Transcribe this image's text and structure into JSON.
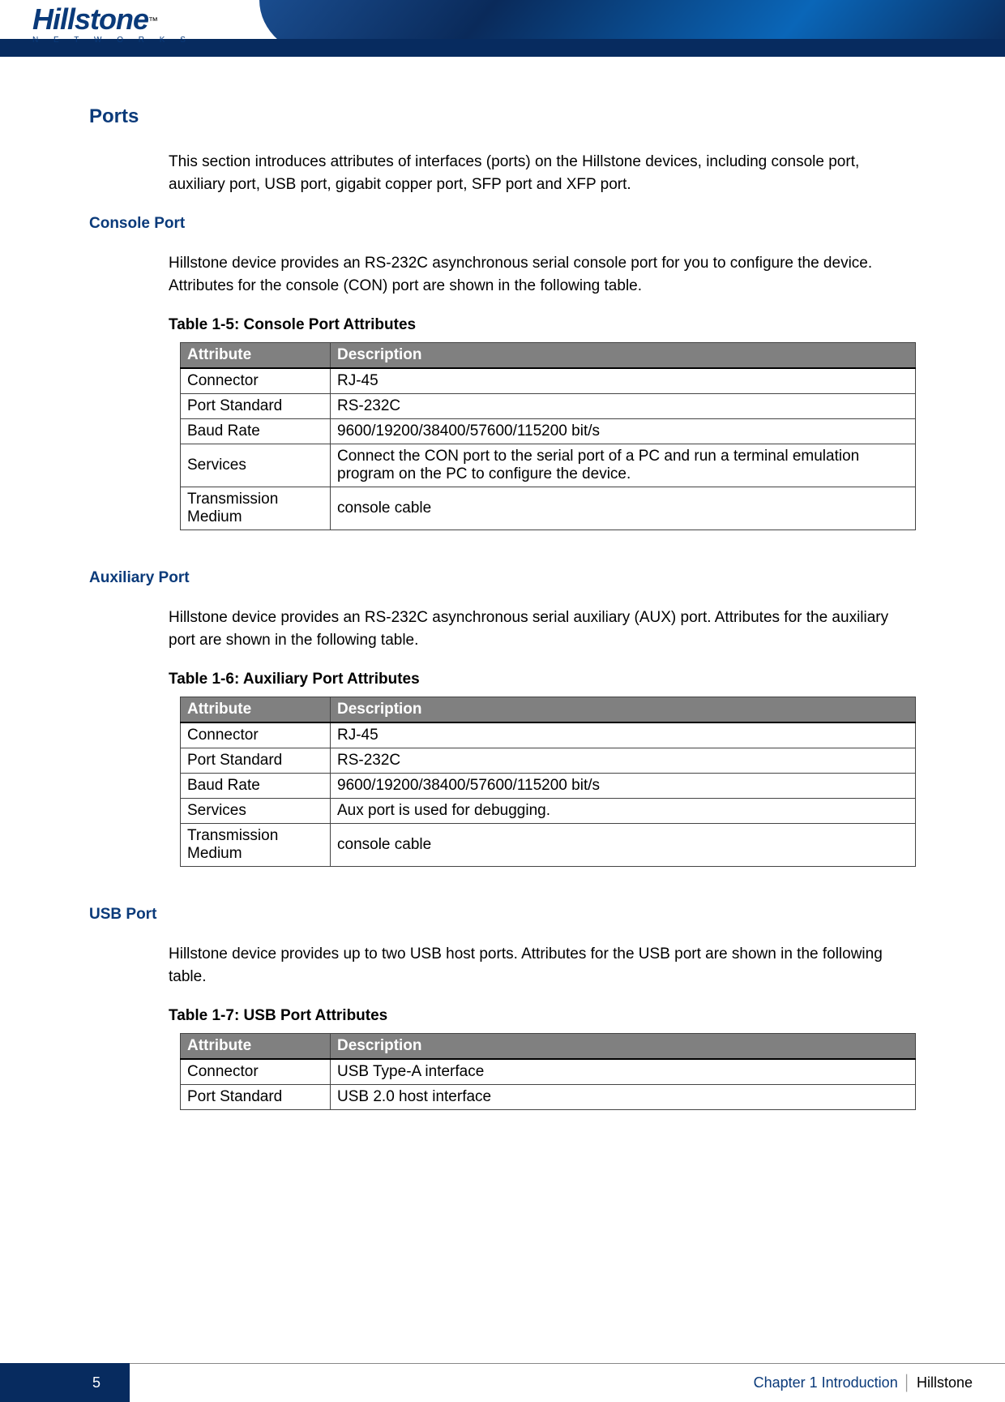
{
  "logo": {
    "text": "Hillstone",
    "tm": "™",
    "sub": "N E T W O R K S"
  },
  "sections": {
    "ports": {
      "title": "Ports",
      "intro": "This section introduces attributes of interfaces (ports) on the Hillstone devices, including console port, auxiliary port, USB port, gigabit copper port, SFP port and XFP port."
    },
    "console": {
      "title": "Console Port",
      "intro": "Hillstone device provides an RS-232C asynchronous serial console port for you to configure the device. Attributes for the console (CON) port are shown in the following table.",
      "caption": "Table 1-5: Console Port Attributes",
      "headers": {
        "attr": "Attribute",
        "desc": "Description"
      },
      "rows": [
        {
          "attr": "Connector",
          "desc": "RJ-45"
        },
        {
          "attr": "Port Standard",
          "desc": "RS-232C"
        },
        {
          "attr": "Baud Rate",
          "desc": "9600/19200/38400/57600/115200 bit/s"
        },
        {
          "attr": "Services",
          "desc": "Connect the CON port to the serial port of a PC and run a terminal emulation program on the PC to configure the device."
        },
        {
          "attr": "Transmission Medium",
          "desc": "console cable"
        }
      ]
    },
    "aux": {
      "title": "Auxiliary Port",
      "intro": "Hillstone device provides an RS-232C asynchronous serial auxiliary (AUX) port. Attributes for the auxiliary port are shown in the following table.",
      "caption": "Table 1-6: Auxiliary Port Attributes",
      "headers": {
        "attr": "Attribute",
        "desc": "Description"
      },
      "rows": [
        {
          "attr": "Connector",
          "desc": "RJ-45"
        },
        {
          "attr": "Port Standard",
          "desc": "RS-232C"
        },
        {
          "attr": "Baud Rate",
          "desc": "9600/19200/38400/57600/115200 bit/s"
        },
        {
          "attr": "Services",
          "desc": "Aux port is used for debugging."
        },
        {
          "attr": "Transmission Medium",
          "desc": "console cable"
        }
      ]
    },
    "usb": {
      "title": "USB Port",
      "intro": "Hillstone device provides up to two USB host ports. Attributes for the USB port are shown in the following table.",
      "caption": "Table 1-7: USB Port Attributes",
      "headers": {
        "attr": "Attribute",
        "desc": "Description"
      },
      "rows": [
        {
          "attr": "Connector",
          "desc": "USB Type-A interface"
        },
        {
          "attr": "Port Standard",
          "desc": "USB 2.0 host interface"
        }
      ]
    }
  },
  "footer": {
    "page": "5",
    "chapter": "Chapter 1 Introduction",
    "brand": "Hillstone"
  }
}
